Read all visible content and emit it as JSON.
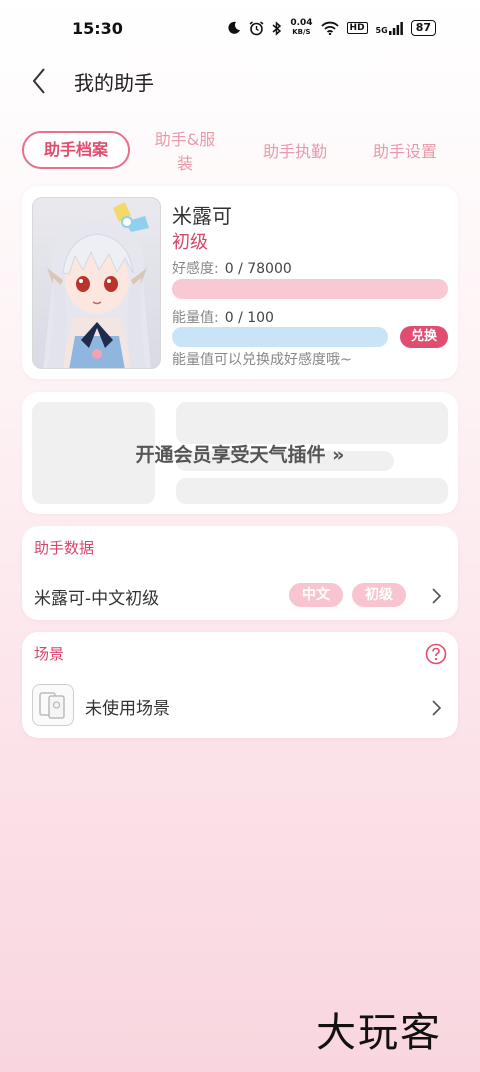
{
  "status_bar": {
    "time": "15:30",
    "network_speed": "0.04",
    "network_unit": "KB/S",
    "hd": "HD",
    "signal_label": "5G",
    "battery": "87"
  },
  "header": {
    "title": "我的助手"
  },
  "tabs": [
    {
      "label": "助手档案",
      "active": true
    },
    {
      "label": "助手&服装"
    },
    {
      "label": "助手执勤"
    },
    {
      "label": "助手设置"
    }
  ],
  "profile": {
    "name": "米露可",
    "level": "初级",
    "affection_label": "好感度:",
    "affection_value": "0 / 78000",
    "affection_progress": 0,
    "energy_label": "能量值:",
    "energy_value": "0 / 100",
    "energy_progress": 0,
    "exchange_label": "兑换",
    "hint": "能量值可以兑换成好感度哦~"
  },
  "weather": {
    "vip_text": "开通会员享受天气插件 »"
  },
  "assistant_data": {
    "title": "助手数据",
    "row_text": "米露可-中文初级",
    "chip_language": "中文",
    "chip_level": "初级"
  },
  "scene": {
    "title": "场景",
    "row_text": "未使用场景"
  },
  "watermark": "大玩客",
  "colors": {
    "accent": "#e14d6f",
    "affection_bar": "#f8c8d3",
    "energy_bar": "#c8e4f6",
    "chip": "#f7c4cf"
  }
}
